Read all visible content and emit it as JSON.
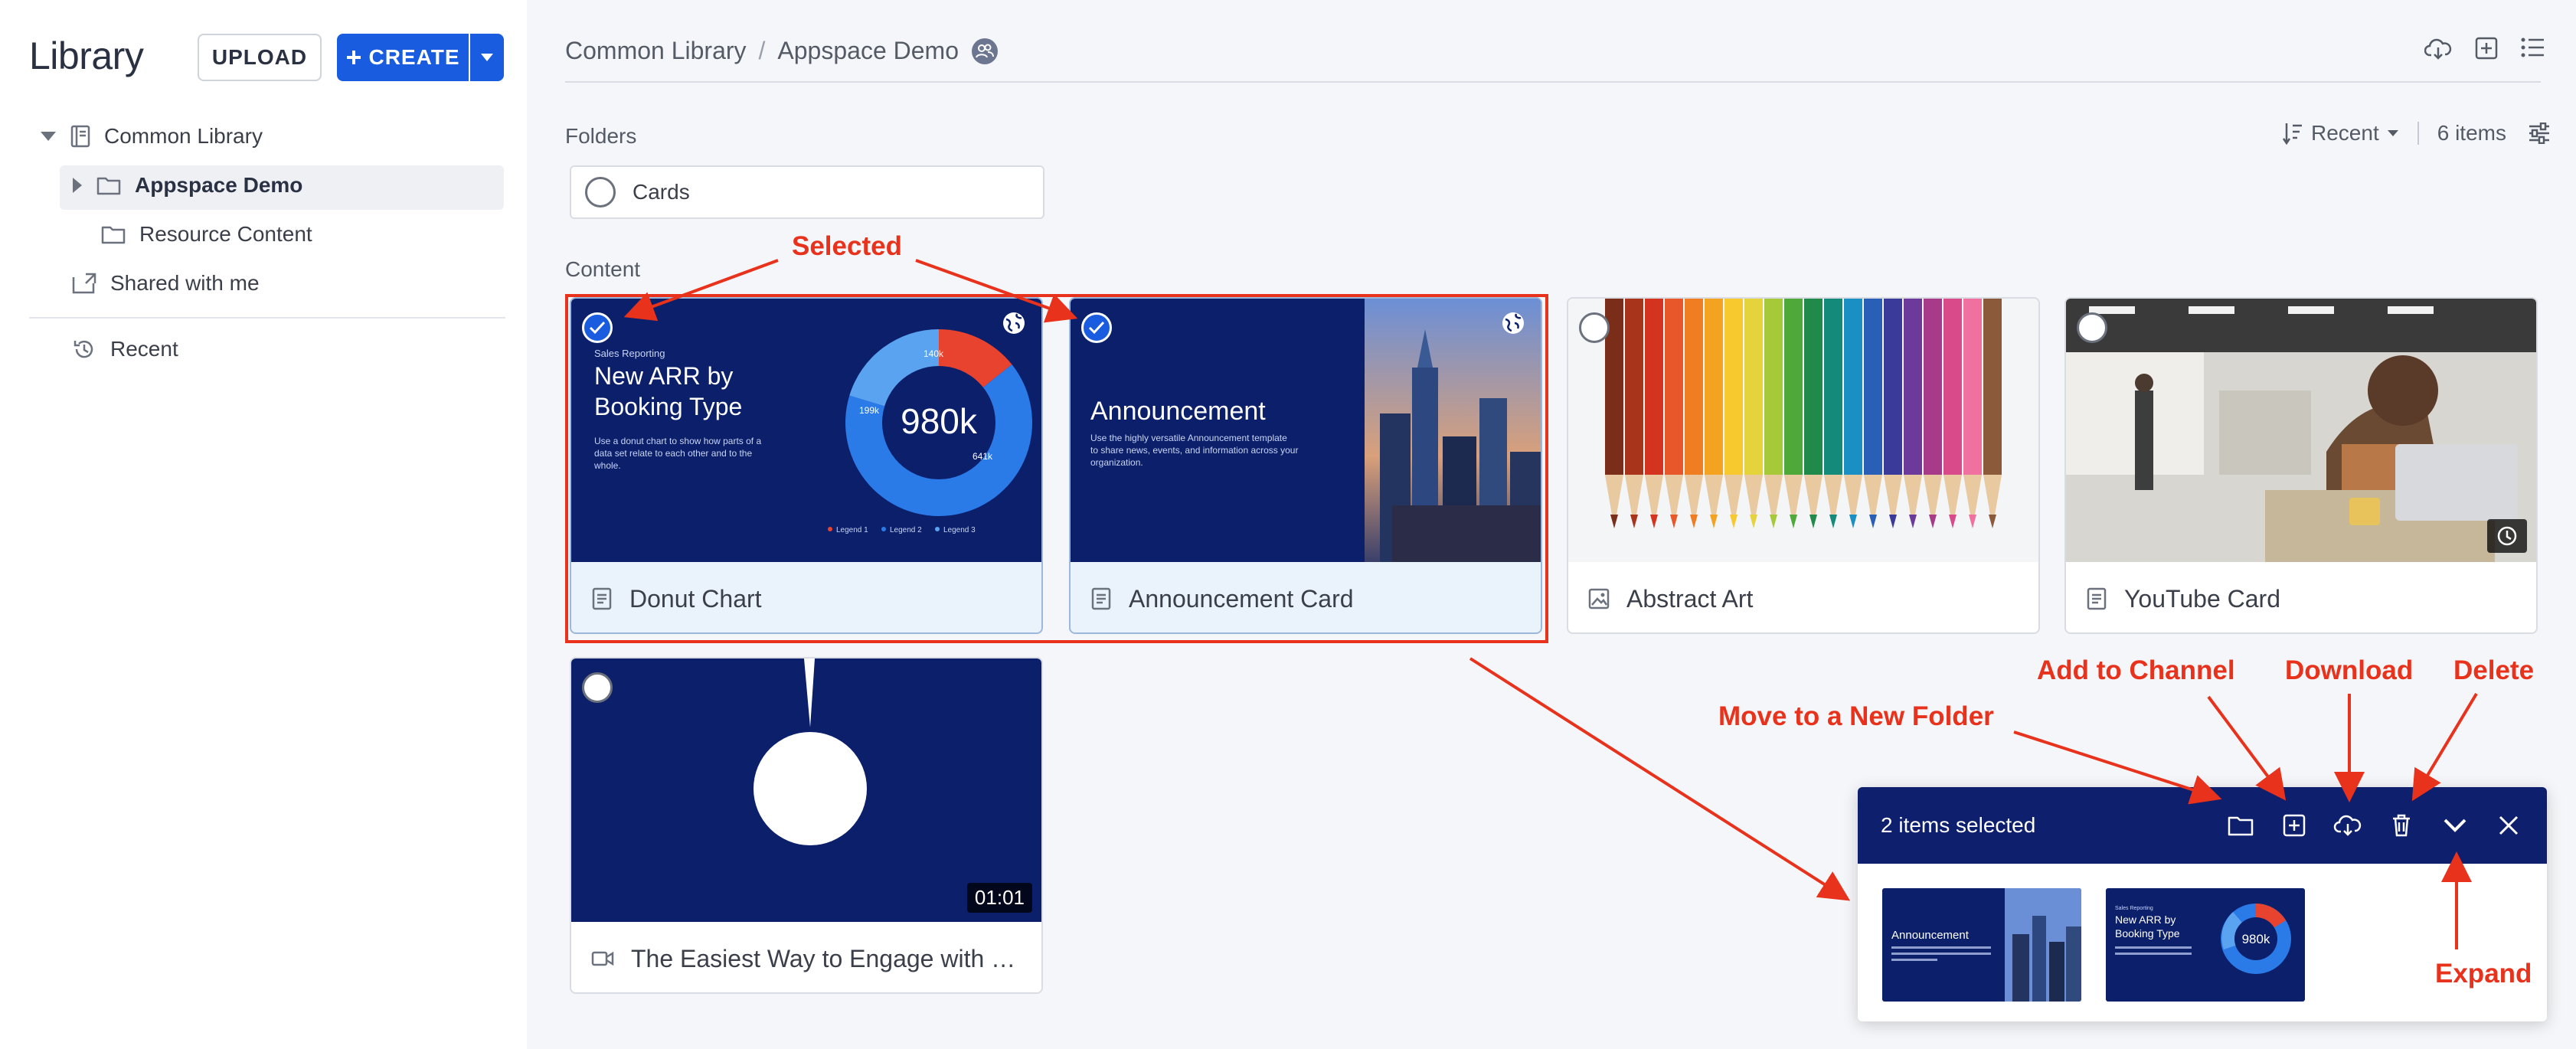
{
  "sidebar": {
    "title": "Library",
    "upload_label": "UPLOAD",
    "create_label": "CREATE",
    "tree": [
      {
        "label": "Common Library",
        "icon": "book-icon"
      },
      {
        "label": "Appspace Demo",
        "icon": "folder-icon",
        "selected": true
      },
      {
        "label": "Resource Content",
        "icon": "folder-icon"
      },
      {
        "label": "Shared with me",
        "icon": "shared-folder-icon"
      },
      {
        "label": "Recent",
        "icon": "history-icon"
      }
    ]
  },
  "header": {
    "breadcrumb": [
      "Common Library",
      "Appspace Demo"
    ],
    "separator": "/"
  },
  "toolbar": {
    "sort_label": "Recent",
    "item_count": "6 items"
  },
  "folders_section": {
    "label": "Folders",
    "items": [
      {
        "name": "Cards"
      }
    ]
  },
  "content_section": {
    "label": "Content",
    "cards": [
      {
        "name": "Donut Chart",
        "type": "document",
        "selected": true,
        "thumb": {
          "kicker": "Sales Reporting",
          "title_line1": "New ARR by",
          "title_line2": "Booking Type",
          "body_line1": "Use a donut chart to show how parts of a",
          "body_line2": "data set relate to each other and to the",
          "body_line3": "whole.",
          "center_value": "980k",
          "slices": [
            {
              "label": "140k",
              "value": 140,
              "color": "#e8432e"
            },
            {
              "label": "641k",
              "value": 641,
              "color": "#2a7ae8"
            },
            {
              "label": "199k",
              "value": 199,
              "color": "#5aa3f0"
            }
          ],
          "legend": [
            "Legend 1",
            "Legend 2",
            "Legend 3"
          ]
        }
      },
      {
        "name": "Announcement Card",
        "type": "document",
        "selected": true,
        "thumb": {
          "title": "Announcement",
          "body_line1": "Use the highly versatile Announcement template",
          "body_line2": "to share news, events, and information across your",
          "body_line3": "organization."
        }
      },
      {
        "name": "Abstract Art",
        "type": "image",
        "selected": false
      },
      {
        "name": "YouTube Card",
        "type": "document",
        "selected": false
      },
      {
        "name": "The Easiest Way to Engage with …",
        "type": "video",
        "selected": false,
        "duration": "01:01"
      }
    ]
  },
  "tray": {
    "count_label": "2 items selected",
    "actions": [
      "folder-move-icon",
      "add-to-channel-icon",
      "download-icon",
      "delete-icon",
      "expand-icon",
      "close-icon"
    ],
    "mini_announcement": "Announcement",
    "mini_donut_kicker": "Sales Reporting",
    "mini_donut_title_line1": "New ARR by",
    "mini_donut_title_line2": "Booking Type",
    "mini_donut_value": "980k"
  },
  "annotations": {
    "selected": "Selected",
    "move": "Move to a New Folder",
    "add_channel": "Add to Channel",
    "download": "Download",
    "delete": "Delete",
    "expand": "Expand"
  },
  "colors": {
    "accent": "#1a5ce0",
    "tray_header": "#0e1f6e",
    "annotation_red": "#e8321c",
    "thumb_navy": "#0b1f6b"
  }
}
